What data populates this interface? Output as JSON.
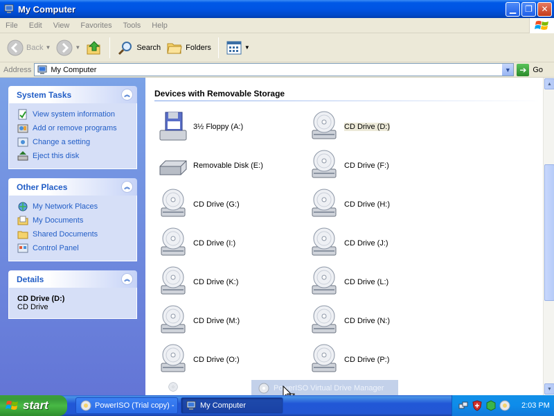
{
  "window": {
    "title": "My Computer"
  },
  "menu": [
    "File",
    "Edit",
    "View",
    "Favorites",
    "Tools",
    "Help"
  ],
  "toolbar": {
    "back_label": "Back",
    "search_label": "Search",
    "folders_label": "Folders"
  },
  "address": {
    "label": "Address",
    "value": "My Computer",
    "go_label": "Go"
  },
  "system_tasks": {
    "title": "System Tasks",
    "items": [
      "View system information",
      "Add or remove programs",
      "Change a setting",
      "Eject this disk"
    ]
  },
  "other_places": {
    "title": "Other Places",
    "items": [
      "My Network Places",
      "My Documents",
      "Shared Documents",
      "Control Panel"
    ]
  },
  "details": {
    "title": "Details",
    "name": "CD Drive (D:)",
    "type": "CD Drive"
  },
  "content": {
    "group_title": "Devices with Removable Storage",
    "drives": [
      {
        "label": "3½ Floppy (A:)",
        "icon": "floppy-drive-icon"
      },
      {
        "label": "CD Drive (D:)",
        "icon": "cd-drive-icon",
        "selected": true
      },
      {
        "label": "Removable Disk (E:)",
        "icon": "removable-disk-icon"
      },
      {
        "label": "CD Drive (F:)",
        "icon": "cd-drive-icon"
      },
      {
        "label": "CD Drive (G:)",
        "icon": "cd-drive-icon"
      },
      {
        "label": "CD Drive (H:)",
        "icon": "cd-drive-icon"
      },
      {
        "label": "CD Drive (I:)",
        "icon": "cd-drive-icon"
      },
      {
        "label": "CD Drive (J:)",
        "icon": "cd-drive-icon"
      },
      {
        "label": "CD Drive (K:)",
        "icon": "cd-drive-icon"
      },
      {
        "label": "CD Drive (L:)",
        "icon": "cd-drive-icon"
      },
      {
        "label": "CD Drive (M:)",
        "icon": "cd-drive-icon"
      },
      {
        "label": "CD Drive (N:)",
        "icon": "cd-drive-icon"
      },
      {
        "label": "CD Drive (O:)",
        "icon": "cd-drive-icon"
      },
      {
        "label": "CD Drive (P:)",
        "icon": "cd-drive-icon"
      }
    ]
  },
  "drag_ghost": {
    "label": "PowerISO Virtual Drive Manager"
  },
  "taskbar": {
    "start_label": "start",
    "tasks": [
      {
        "label": "PowerISO (Trial copy) -",
        "active": false
      },
      {
        "label": "My Computer",
        "active": true
      }
    ],
    "clock": "2:03 PM"
  }
}
